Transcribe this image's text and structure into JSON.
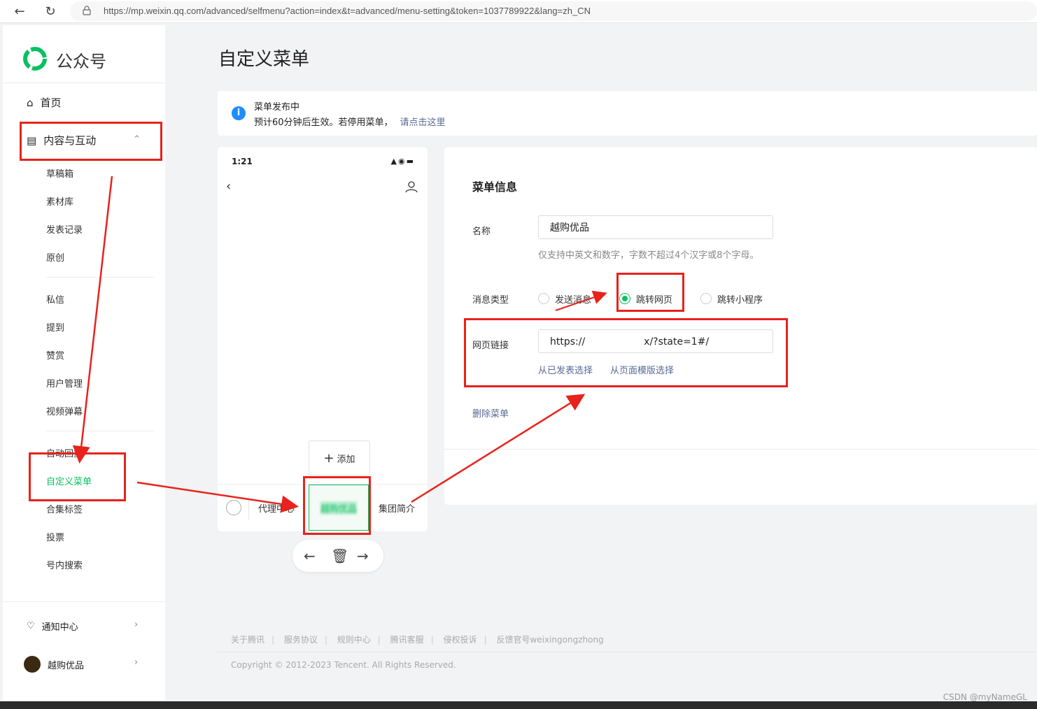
{
  "browser": {
    "url": "https://mp.weixin.qq.com/advanced/selfmenu?action=index&t=advanced/menu-setting&token=1037789922&lang=zh_CN"
  },
  "sidebar": {
    "brand": "公众号",
    "home": "首页",
    "content_group": "内容与互动",
    "sub_items_1": [
      "草稿箱",
      "素材库",
      "发表记录",
      "原创"
    ],
    "sub_items_2": [
      "私信",
      "提到",
      "赞赏",
      "用户管理",
      "视频弹幕"
    ],
    "sub_items_3": [
      "自动回复",
      "自定义菜单",
      "合集标签",
      "投票",
      "号内搜索"
    ],
    "notifications": "通知中心",
    "account": "越购优品"
  },
  "page": {
    "title": "自定义菜单"
  },
  "notice": {
    "title": "菜单发布中",
    "text": "预计60分钟后生效。若停用菜单，",
    "link": "请点击这里"
  },
  "phone": {
    "time": "1:21",
    "add_label": "添加",
    "menu": [
      "代理中心",
      "越购优品",
      "集团简介"
    ]
  },
  "panel": {
    "title": "菜单信息",
    "name_label": "名称",
    "name_value": "越购优品",
    "name_hint": "仅支持中英文和数字，字数不超过4个汉字或8个字母。",
    "type_label": "消息类型",
    "type_options": [
      "发送消息",
      "跳转网页",
      "跳转小程序"
    ],
    "type_selected": "跳转网页",
    "url_label": "网页链接",
    "url_value": "https://      x/?state=1#/",
    "from_published": "从已发表选择",
    "from_template": "从页面模版选择",
    "delete": "删除菜单"
  },
  "footer": {
    "links": [
      "关于腾讯",
      "服务协议",
      "规则中心",
      "腾讯客服",
      "侵权投诉",
      "反馈官号weixingongzhong"
    ],
    "copyright": "Copyright © 2012-2023 Tencent. All Rights Reserved."
  },
  "watermark": "CSDN @myNameGL",
  "colors": {
    "accent": "#07c160",
    "link": "#576b95",
    "annotation": "#e8221c"
  }
}
